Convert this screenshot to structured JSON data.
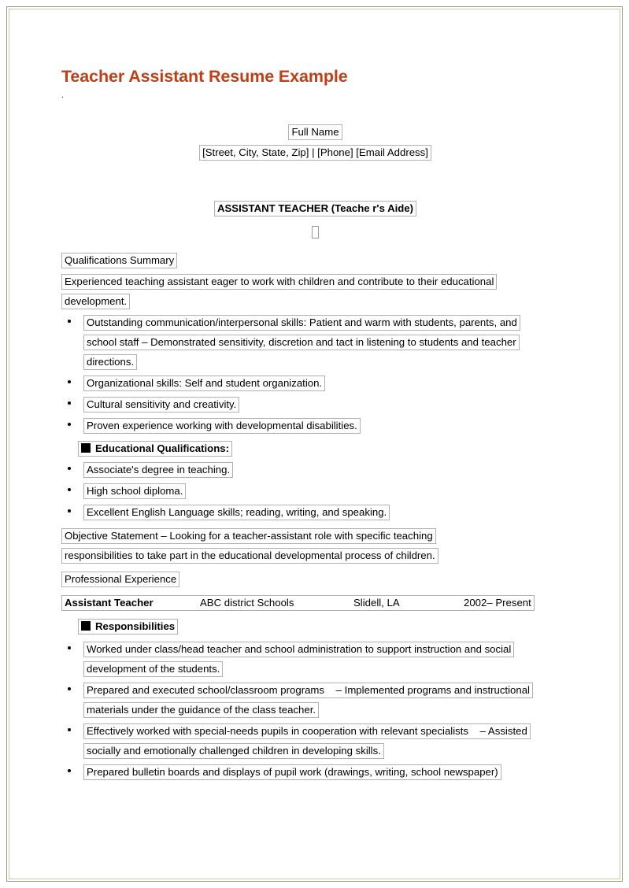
{
  "document": {
    "title": "Teacher Assistant Resume Example",
    "title_color": "#c03f17",
    "stray_mark": ".",
    "header": {
      "full_name": "Full Name",
      "contact_line": "[Street, City, State, Zip] | [Phone] [Email Address]",
      "job_title": "ASSISTANT TEACHER (Teache r's Aide)",
      "missing_glyph": ""
    },
    "sections": {
      "qualifications": {
        "heading": "Qualifications Summary",
        "summary_lines": [
          "Experienced teaching assistant eager to work with children and contribute to their educational",
          "development."
        ],
        "bullets": [
          [
            "Outstanding communication/interpersonal skills: Patient and warm with students, parents, and",
            "school staff – Demonstrated sensitivity, discretion and tact in listening to students and teacher",
            "directions."
          ],
          [
            "Organizational skills: Self and student organization."
          ],
          [
            "Cultural sensitivity and creativity."
          ],
          [
            "Proven experience working with developmental disabilities."
          ]
        ]
      },
      "education": {
        "heading": "Educational Qualifications:",
        "bullets": [
          [
            "Associate's degree in teaching."
          ],
          [
            "High school diploma."
          ],
          [
            "Excellent English Language skills; reading, writing, and speaking."
          ]
        ]
      },
      "objective": {
        "label": "Objective Statement",
        "line1_rest": " – Looking for a teacher-assistant role with specific teaching",
        "line2": "responsibilities to take part in the educational developmental process of children."
      },
      "experience": {
        "heading": "Professional Experience",
        "job": {
          "position": "Assistant Teacher",
          "employer": "ABC district Schools",
          "location": "Slidell, LA",
          "dates": "2002– Present"
        },
        "responsibilities_heading": "Responsibilities",
        "bullets": [
          [
            "Worked under class/head teacher and school administration to support instruction and social",
            "development of the students."
          ],
          [
            "Prepared and executed school/classroom programs    – Implemented programs and instructional",
            "materials under the guidance of the class teacher."
          ],
          [
            "Effectively worked with special-needs pupils in cooperation with relevant specialists    – Assisted",
            "socially and emotionally challenged children in developing skills."
          ],
          [
            "Prepared bulletin boards and displays of pupil work (drawings, writing, school newspaper)"
          ]
        ]
      }
    }
  }
}
